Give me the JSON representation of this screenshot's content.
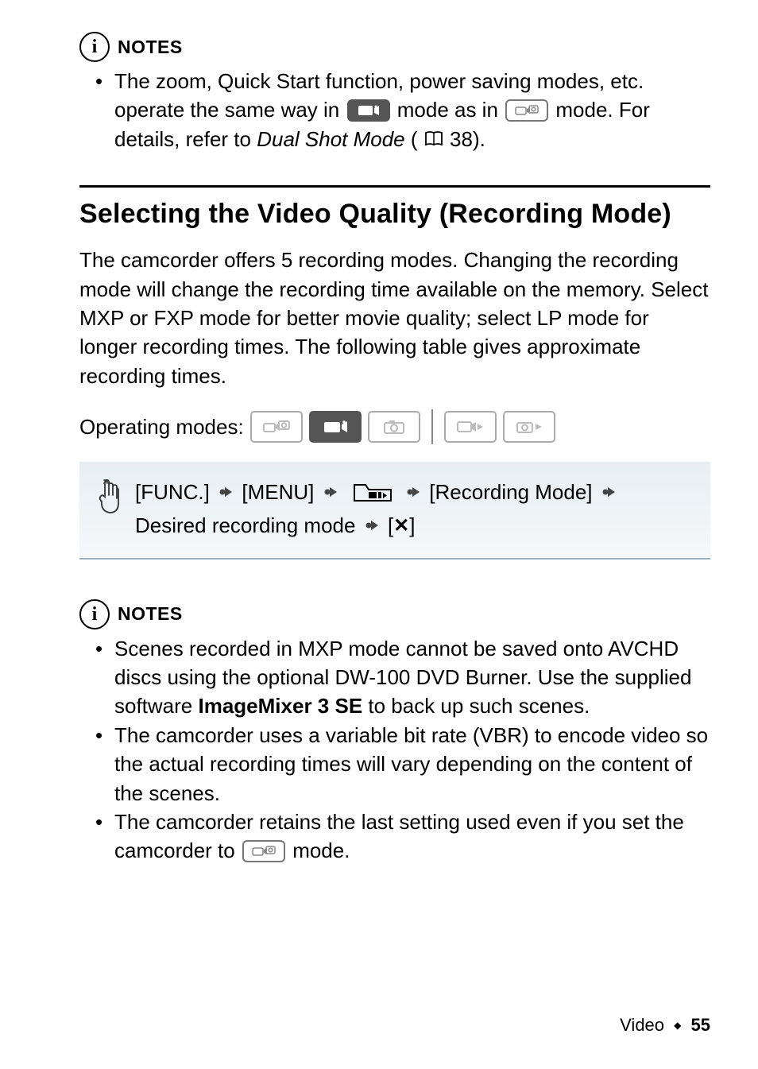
{
  "notes1": {
    "label": "NOTES",
    "bullet1_a": "The zoom, Quick Start function, power saving modes, etc. operate the same way in ",
    "bullet1_b": " mode as in ",
    "bullet1_c": " mode. For details, refer to ",
    "bullet1_ref": "Dual Shot Mode",
    "bullet1_d": " (",
    "bullet1_page": " 38).",
    "info_glyph": "i"
  },
  "section": {
    "title": "Selecting the Video Quality (Recording Mode)",
    "body": "The camcorder offers 5 recording modes. Changing the recording mode will change the recording time available on the memory. Select MXP or FXP mode for better movie quality; select LP mode for longer recording times. The following table gives approximate recording times."
  },
  "operating_modes": {
    "label": "Operating modes:"
  },
  "procedure": {
    "step1": "[FUNC.]",
    "step2": "[MENU]",
    "step3": "[Recording Mode]",
    "step4a": "Desired recording mode",
    "step4b": "[",
    "step4c": "]"
  },
  "notes2": {
    "label": "NOTES",
    "info_glyph": "i",
    "b1a": "Scenes recorded in MXP mode cannot be saved onto AVCHD discs using the optional DW-100 DVD Burner. Use the supplied software ",
    "b1bold": "ImageMixer 3 SE",
    "b1b": " to back up such scenes.",
    "b2": "The camcorder uses a variable bit rate (VBR) to encode video so the actual recording times will vary depending on the content of the scenes.",
    "b3a": "The camcorder retains the last setting used even if you set the camcorder to ",
    "b3b": " mode."
  },
  "footer": {
    "section": "Video",
    "diamond": "◆",
    "page": "55"
  },
  "icons": {
    "video_cam": "video-camera-icon",
    "dual_shot": "dual-shot-icon",
    "photo_cam": "photo-camera-icon",
    "playback_video": "playback-video-icon",
    "playback_photo": "playback-photo-icon",
    "rec_tab": "recording-tab-icon",
    "hand": "hand-icon",
    "arrow": "arrow-icon",
    "close": "close-icon",
    "book": "book-icon",
    "info": "info-icon"
  }
}
